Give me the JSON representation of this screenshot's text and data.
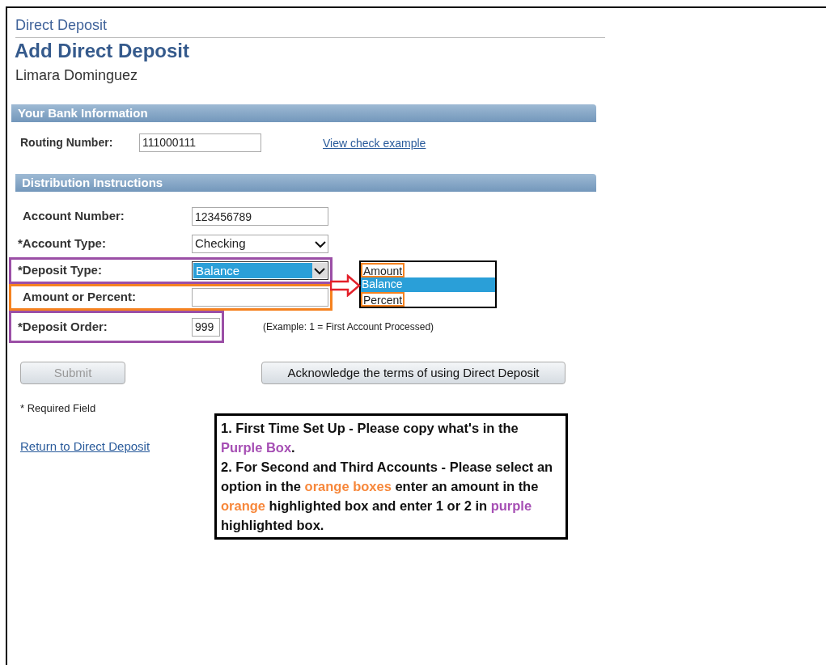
{
  "header": {
    "breadcrumb": "Direct Deposit",
    "title": "Add Direct Deposit",
    "employee": "Limara Dominguez"
  },
  "bank_section": {
    "title": "Your Bank Information",
    "routing_label": "Routing Number:",
    "routing_value": "111000111",
    "link": "View check example"
  },
  "distribution_section": {
    "title": "Distribution Instructions"
  },
  "fields": [
    {
      "kind": "input",
      "label": "Account Number:",
      "value": "123456789"
    },
    {
      "kind": "select",
      "label": "*Account Type:",
      "value": "Checking",
      "focused": false
    },
    {
      "kind": "select",
      "label": "*Deposit Type:",
      "value": "Balance",
      "focused": true,
      "color": "#9b4fa6"
    },
    {
      "kind": "input",
      "label": "Amount or Percent:",
      "color": "#f58220"
    },
    {
      "kind": "short",
      "label": "*Deposit Order:",
      "value": "999",
      "hint": "(Example: 1 = First Account Processed)",
      "color": "#9b4fa6"
    }
  ],
  "dropdown_options": [
    {
      "label": "Amount",
      "selected": false,
      "color": "#f58220"
    },
    {
      "label": "Balance",
      "selected": true
    },
    {
      "label": "Percent",
      "selected": false,
      "color": "#f58220"
    }
  ],
  "buttons": [
    {
      "label": "Submit",
      "disabled": true
    },
    {
      "label": "Acknowledge the terms of using Direct Deposit",
      "disabled": false
    }
  ],
  "required_note": "* Required Field",
  "return_link": "Return to Direct Deposit",
  "note_lines": [
    [
      {
        "text": "1. First Time Set Up - Please copy what's in the "
      },
      {
        "text": "Purple Box",
        "color": "#a64fb4"
      },
      {
        "text": "."
      }
    ],
    [
      {
        "text": "2. For Second and Third Accounts - Please select an option in the "
      },
      {
        "text": "orange boxes",
        "color": "#f7873a"
      },
      {
        "text": " enter an amount in the "
      },
      {
        "text": "orange",
        "color": "#f7873a"
      },
      {
        "text": " highlighted box and enter 1 or 2 in "
      },
      {
        "text": "purple",
        "color": "#a64fb4"
      },
      {
        "text": " highlighted box."
      }
    ]
  ]
}
